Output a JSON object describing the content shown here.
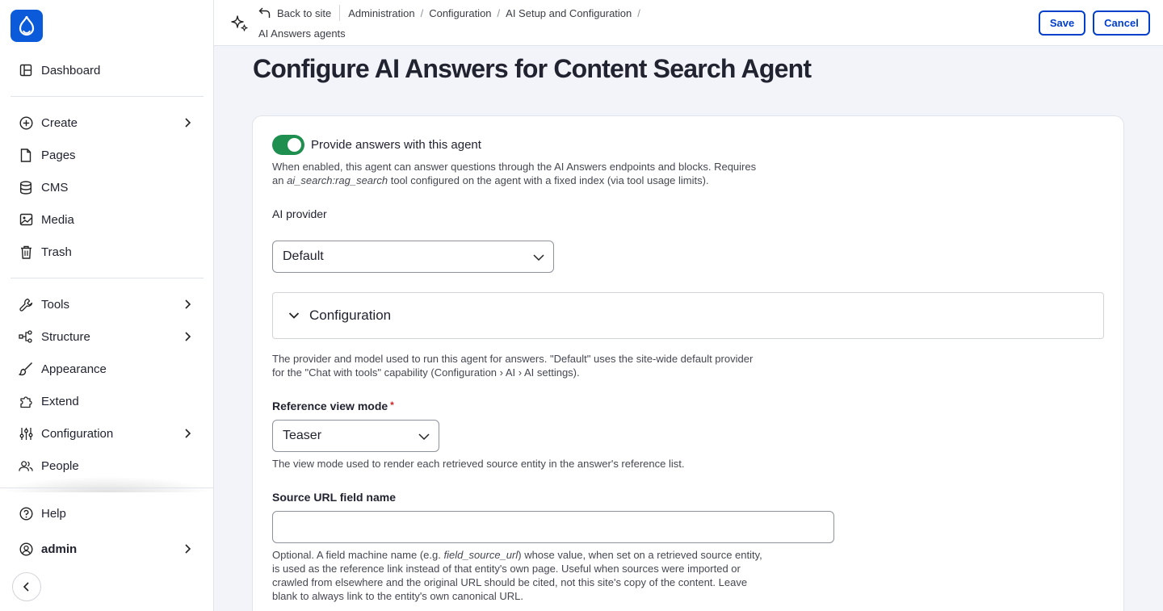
{
  "sidebar": {
    "items": [
      {
        "label": "Dashboard",
        "icon": "dashboard-icon"
      },
      {
        "label": "Create",
        "icon": "plus-circle-icon"
      },
      {
        "label": "Pages",
        "icon": "page-icon"
      },
      {
        "label": "CMS",
        "icon": "database-icon"
      },
      {
        "label": "Media",
        "icon": "image-icon"
      },
      {
        "label": "Trash",
        "icon": "trash-icon"
      },
      {
        "label": "Tools",
        "icon": "wrench-icon"
      },
      {
        "label": "Structure",
        "icon": "structure-icon"
      },
      {
        "label": "Appearance",
        "icon": "brush-icon"
      },
      {
        "label": "Extend",
        "icon": "puzzle-icon"
      },
      {
        "label": "Configuration",
        "icon": "sliders-icon"
      },
      {
        "label": "People",
        "icon": "people-icon"
      },
      {
        "label": "Help",
        "icon": "help-icon"
      },
      {
        "label": "admin",
        "icon": "user-icon"
      }
    ]
  },
  "topbar": {
    "back_label": "Back to site",
    "breadcrumbs": [
      "Administration",
      "Configuration",
      "AI Setup and Configuration",
      "AI Answers agents"
    ],
    "save_label": "Save",
    "cancel_label": "Cancel"
  },
  "page": {
    "title": "Configure AI Answers for Content Search Agent"
  },
  "form": {
    "toggle_label": "Provide answers with this agent",
    "toggle_on": true,
    "toggle_desc_1": "When enabled, this agent can answer questions through the AI Answers endpoints and blocks. Requires",
    "toggle_desc_2a": "an ",
    "toggle_desc_2_code": "ai_search:rag_search",
    "toggle_desc_2b": " tool configured on the agent with a fixed index (via tool usage limits).",
    "provider_label": "AI provider",
    "provider_value": "Default",
    "config_summary": "Configuration",
    "provider_desc_1": "The provider and model used to run this agent for answers. \"Default\" uses the site-wide default provider",
    "provider_desc_2": "for the \"Chat with tools\" capability (Configuration › AI › AI settings).",
    "view_mode_label": "Reference view mode",
    "required_mark": "*",
    "view_mode_value": "Teaser",
    "view_mode_desc": "The view mode used to render each retrieved source entity in the answer's reference list.",
    "source_url_label": "Source URL field name",
    "source_url_value": "",
    "source_desc_1a": "Optional. A field machine name (e.g. ",
    "source_desc_1_code": "field_source_url",
    "source_desc_1b": ") whose value, when set on a retrieved source entity,",
    "source_desc_2": "is used as the reference link instead of that entity's own page. Useful when sources were imported or",
    "source_desc_3": "crawled from elsewhere and the original URL should be cited, not this site's copy of the content. Leave",
    "source_desc_4": "blank to always link to the entity's own canonical URL."
  },
  "colors": {
    "accent": "#003ecc",
    "logo": "#0a5ad9",
    "toggle_on": "#1f8f50",
    "required": "#d72222"
  }
}
